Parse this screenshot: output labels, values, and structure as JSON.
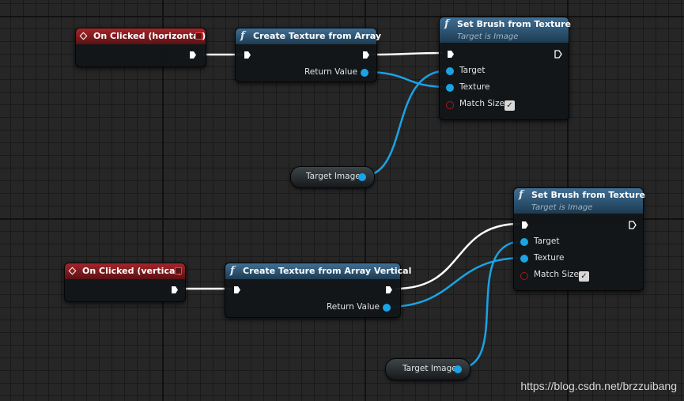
{
  "colors": {
    "exec_wire": "#ffffff",
    "data_wire": "#1aa3e6",
    "event_header": "#a4262b",
    "function_header": "#3f6f95",
    "background": "#262626"
  },
  "nodes": {
    "on_clicked_h": {
      "title": "On Clicked (horizontal)",
      "icon": "event-diamond-icon"
    },
    "create_texture": {
      "title": "Create Texture from Array",
      "return_label": "Return Value",
      "icon": "function-icon"
    },
    "set_brush_1": {
      "title": "Set Brush from Texture",
      "subtitle": "Target is Image",
      "target_label": "Target",
      "texture_label": "Texture",
      "match_size_label": "Match Size",
      "match_size_checked": true
    },
    "target_image_1": {
      "label": "Target Image"
    },
    "on_clicked_v": {
      "title": "On Clicked (vertical)",
      "icon": "event-diamond-icon"
    },
    "create_texture_v": {
      "title": "Create Texture from Array Vertical",
      "return_label": "Return Value",
      "icon": "function-icon"
    },
    "set_brush_2": {
      "title": "Set Brush from Texture",
      "subtitle": "Target is Image",
      "target_label": "Target",
      "texture_label": "Texture",
      "match_size_label": "Match Size",
      "match_size_checked": true
    },
    "target_image_2": {
      "label": "Target Image"
    }
  },
  "watermark": "https://blog.csdn.net/brzzuibang"
}
